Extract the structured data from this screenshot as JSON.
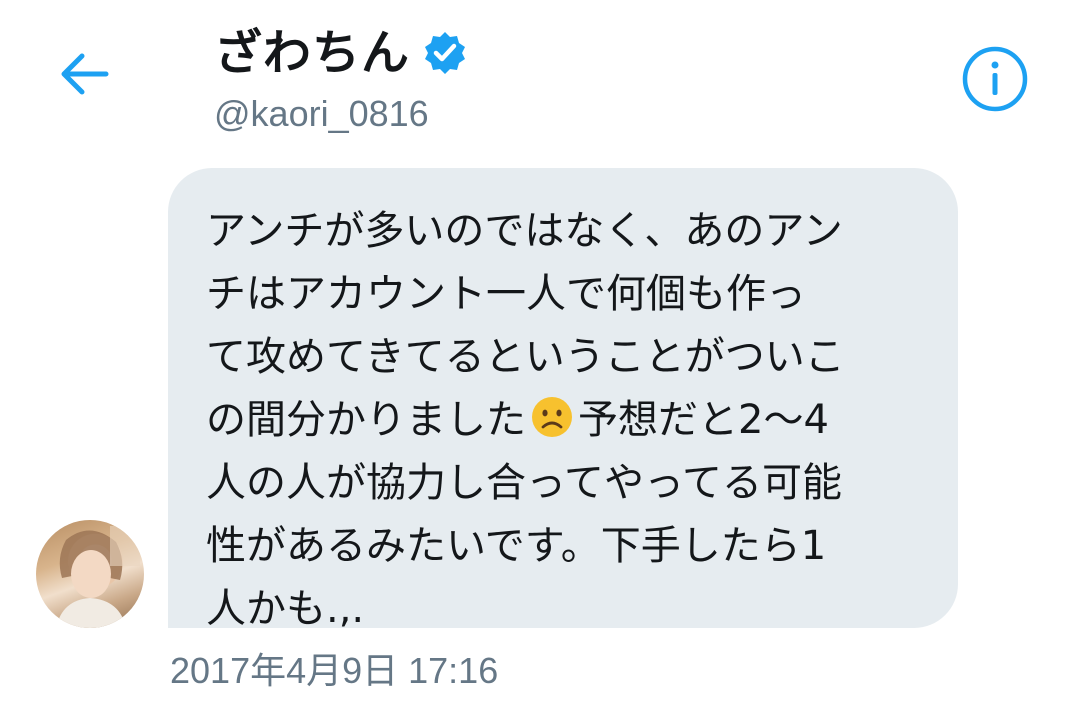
{
  "header": {
    "display_name": "ざわちん",
    "handle": "@kaori_0816",
    "back_icon": "arrow-left-icon",
    "info_icon": "info-circle-icon",
    "verified_icon": "verified-badge-icon"
  },
  "message": {
    "lines": [
      "アンチが多いのではなく、あのアン",
      "チはアカウント一人で何個も作っ",
      "て攻めてきてるということがついこ",
      "の間分かりました",
      "予想だと2〜4",
      "人の人が協力し合ってやってる可能",
      "性があるみたいです。下手したら1",
      "人かも.,."
    ],
    "emoji": "frowning-face-emoji"
  },
  "timestamp": "2017年4月9日 17:16",
  "colors": {
    "accent": "#1da1f2",
    "bubble": "#e6ecf0",
    "text": "#14171a",
    "secondary": "#657786"
  }
}
